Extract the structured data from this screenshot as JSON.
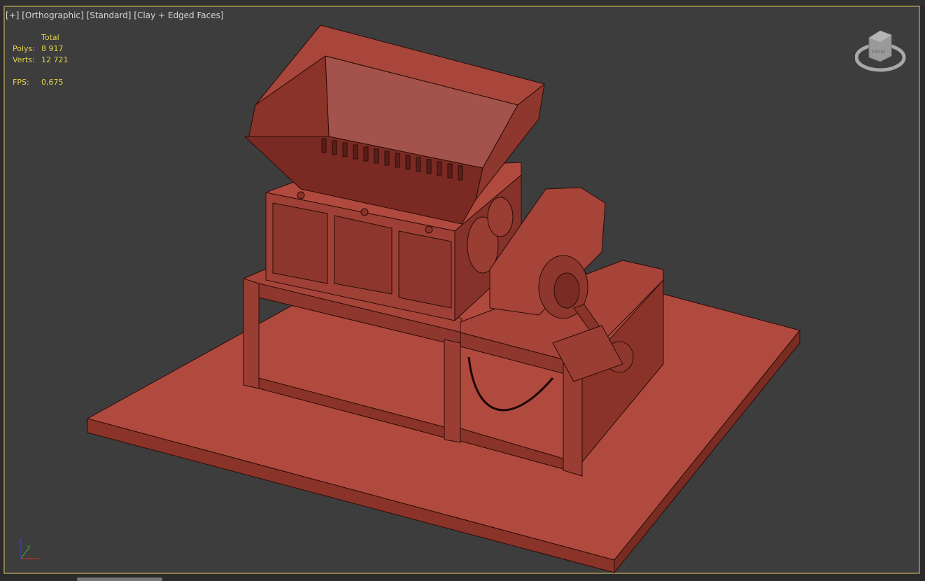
{
  "viewport": {
    "labels": [
      "[+]",
      "[Orthographic]",
      "[Standard]",
      "[Clay + Edged Faces]"
    ],
    "stats": {
      "header": "Total",
      "polys_label": "Polys:",
      "polys_value": "8 917",
      "verts_label": "Verts:",
      "verts_value": "12 721",
      "fps_label": "FPS:",
      "fps_value": "0,675"
    },
    "viewcube_face": "FRONT",
    "axis_labels": {
      "z": "z",
      "y": "y",
      "x": "x"
    }
  },
  "colors": {
    "clay": "#b04a3e",
    "border": "#8c7d4c",
    "stats": "#e2d34a",
    "bg": "#3d3d3d"
  }
}
